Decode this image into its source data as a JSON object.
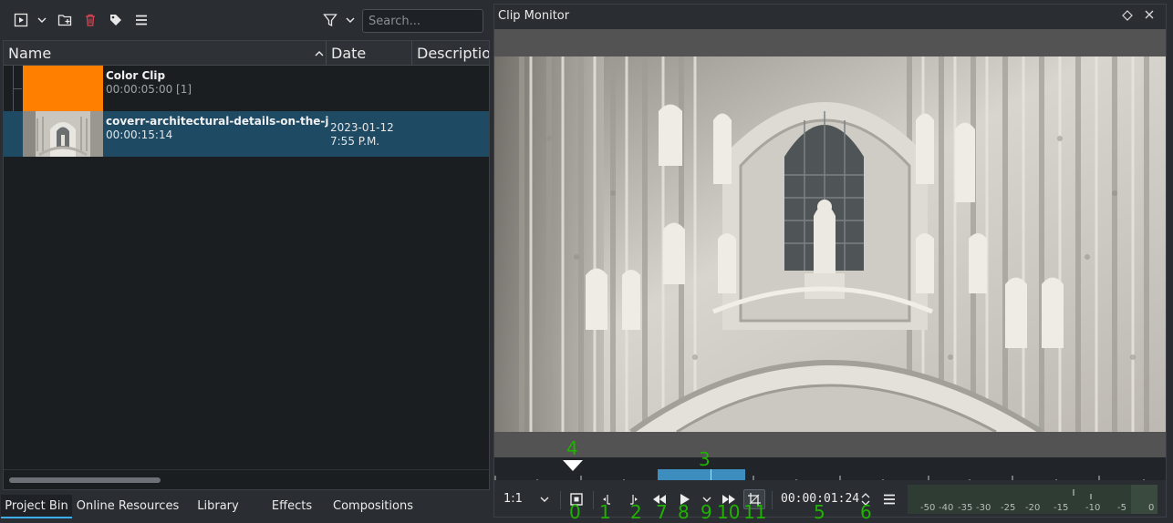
{
  "bin_toolbar": {
    "search_placeholder": "Search..."
  },
  "bin_columns": [
    "Name",
    "Date",
    "Description"
  ],
  "clips": [
    {
      "name": "Color Clip",
      "duration": "00:00:05:00 [1]",
      "date": "",
      "time": "",
      "thumb_color": "#ff7f00"
    },
    {
      "name": "coverr-architectural-details-on-the-jeronimos-monastery",
      "duration": "00:00:15:14",
      "date": "2023-01-12",
      "time": "7:55 P.M."
    }
  ],
  "bin_tabs": [
    "Project Bin",
    "Online Resources",
    "Library",
    "Effects",
    "Compositions"
  ],
  "monitor": {
    "title": "Clip Monitor",
    "zoom": "1:1",
    "timecode": "00:00:01:24",
    "meter_labels": [
      "-50",
      "-40",
      "-35",
      "-30",
      "-25",
      "-20",
      "-15",
      "-10",
      "-5",
      "0"
    ]
  },
  "overlay_markers": [
    "0",
    "1",
    "2",
    "3",
    "4",
    "5",
    "6",
    "7",
    "8",
    "9",
    "10",
    "11"
  ],
  "colors": {
    "accent": "#3daee9",
    "selection": "#1e4a63",
    "zone": "#3d8ebf",
    "marker": "#1fb300",
    "delete": "#da4453"
  }
}
